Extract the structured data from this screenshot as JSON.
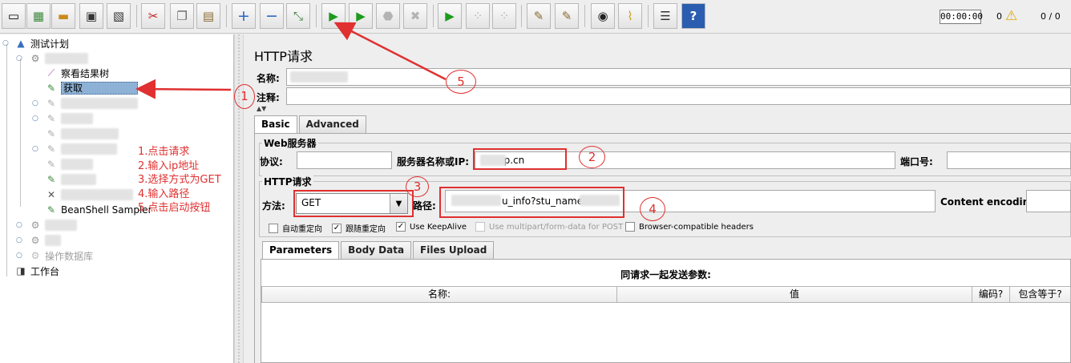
{
  "toolbar": {
    "buttons": [
      {
        "name": "new-icon"
      },
      {
        "name": "templates-icon"
      },
      {
        "name": "open-icon"
      },
      {
        "name": "save-icon"
      },
      {
        "name": "save-as-icon"
      },
      {
        "name": "cut-icon"
      },
      {
        "name": "copy-icon"
      },
      {
        "name": "paste-icon"
      },
      {
        "name": "expand-icon"
      },
      {
        "name": "collapse-icon"
      },
      {
        "name": "toggle-icon"
      },
      {
        "name": "start-icon"
      },
      {
        "name": "start-no-pause-icon"
      },
      {
        "name": "stop-icon"
      },
      {
        "name": "shutdown-icon"
      },
      {
        "name": "remote-start-icon"
      },
      {
        "name": "remote-stop-icon"
      },
      {
        "name": "remote-exit-icon"
      },
      {
        "name": "clear-icon"
      },
      {
        "name": "clear-all-icon"
      },
      {
        "name": "search-binoculars-icon"
      },
      {
        "name": "reset-search-broom-icon"
      },
      {
        "name": "function-helper-icon"
      },
      {
        "name": "help-icon"
      }
    ],
    "timer": "00:00:00",
    "warning_count": "0",
    "thread_count": "0 / 0"
  },
  "tree": {
    "root": "测试计划",
    "results_tree": "察看结果树",
    "selected_sampler": "获取",
    "beanshell": "BeanShell Sampler",
    "db_ops": "操作数据库",
    "workbench": "工作台"
  },
  "panel": {
    "title": "HTTP请求",
    "name_label": "名称:",
    "comment_label": "注释:",
    "tabs": [
      "Basic",
      "Advanced"
    ],
    "web_server_group": "Web服务器",
    "protocol_label": "协议:",
    "server_label": "服务器名称或IP:",
    "server_value": "np.cn",
    "port_label": "端口号:",
    "http_group": "HTTP请求",
    "method_label": "方法:",
    "method_value": "GET",
    "path_label": "路径:",
    "path_value": "u_info?stu_name",
    "encoding_label": "Content encoding:",
    "checkboxes": [
      {
        "label": "自动重定向",
        "checked": false,
        "enabled": true
      },
      {
        "label": "跟随重定向",
        "checked": true,
        "enabled": true
      },
      {
        "label": "Use KeepAlive",
        "checked": true,
        "enabled": true
      },
      {
        "label": "Use multipart/form-data for POST",
        "checked": false,
        "enabled": false
      },
      {
        "label": "Browser-compatible headers",
        "checked": false,
        "enabled": true
      }
    ],
    "sub_tabs": [
      "Parameters",
      "Body Data",
      "Files Upload"
    ],
    "params_caption": "同请求一起发送参数:",
    "columns": [
      "名称:",
      "值",
      "编码?",
      "包含等于?"
    ]
  },
  "annotations": {
    "steps": [
      "1.点击请求",
      "2.输入ip地址",
      "3.选择方式为GET",
      "4.输入路径",
      "5.点击启动按钮"
    ],
    "markers": [
      "1",
      "2",
      "3",
      "4",
      "5"
    ],
    "color": "#e03030"
  }
}
